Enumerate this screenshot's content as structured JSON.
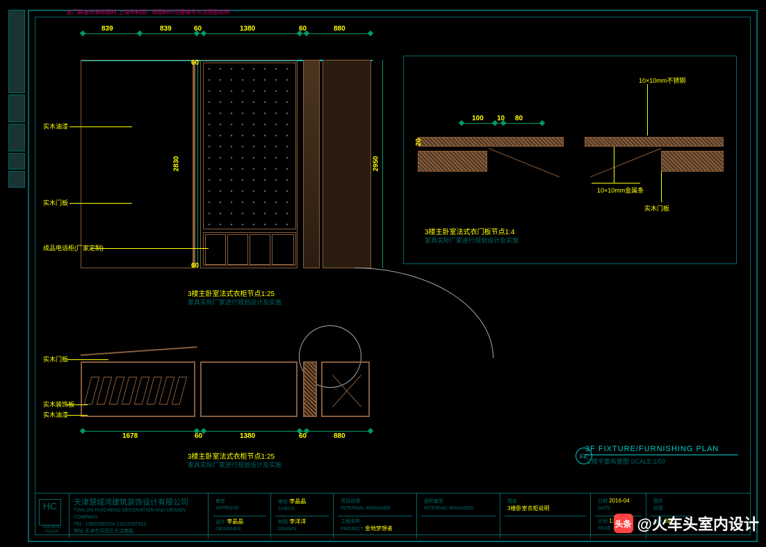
{
  "header": {
    "note": "此门联窗分装修图样 上海市制版厂规图制作活用编号与活用图说明"
  },
  "dimensions": {
    "top": [
      "839",
      "839",
      "60",
      "1380",
      "60",
      "880"
    ],
    "left_height": "2830",
    "right_height": "2950",
    "small_top": "60",
    "small_bottom": "60",
    "bottom": [
      "1678",
      "60",
      "1380",
      "60",
      "880"
    ],
    "detail_top": [
      "100",
      "10",
      "80"
    ],
    "detail_left": "20"
  },
  "labels": {
    "elev_1": "实木油漆",
    "elev_2": "实木门板",
    "elev_3": "成品电话柜(厂家定制)",
    "detail_r1": "10×10mm不锈钢",
    "detail_r2": "10×10mm金属条",
    "detail_r3": "实木门板",
    "plan_1": "实木门板",
    "plan_2": "实木装饰板",
    "plan_3": "实木油漆"
  },
  "captions": {
    "elev_title": "3楼主卧室法式衣柜节点1:25",
    "elev_sub": "家具实际厂家进行规划设计及实施",
    "detail_title": "3楼主卧室法式衣门板节点1:4",
    "detail_sub": "家具实际厂家进行规划设计及实施",
    "plan_title": "3楼主卧室法式衣柜节点1:25",
    "plan_sub": "家具实际厂家进行规划设计及实施"
  },
  "sheet_title": {
    "marker": "FF",
    "en": "3F FIXTURE/FURNISHING PLAN",
    "cn": "三楼平面布置图    SCALE:1/50"
  },
  "title_block": {
    "logo_text": "HC",
    "logo_sub": "HUICHENG DESIGN",
    "company_cn": "天津慧城湾建筑装饰设计有限公司",
    "company_en": "TIAN JIN HUICHENG DECORATION AND DESIGN COMPANY",
    "tel": "TEL: 13820593158  13212097315",
    "addr": "地址:天津市河西区大沽南路"
  },
  "tb_fields": [
    {
      "l1": "审定",
      "v1": "",
      "l2": "APPROVE",
      "v2": ""
    },
    {
      "l1": "设计",
      "v1": "李晶晶",
      "l2": "DESIGNER",
      "v2": ""
    },
    {
      "l1": "审核",
      "v1": "李晶晶",
      "l2": "CHECK",
      "v2": ""
    },
    {
      "l1": "制图",
      "v1": "李洋洋",
      "l2": "DRAWN",
      "v2": ""
    },
    {
      "l1": "项目经理",
      "v1": "",
      "l2": "INTERNAL MANAGER",
      "v2": ""
    },
    {
      "l1": "工程名称",
      "v1": "金地梦想者",
      "l2": "PROJECT",
      "v2": ""
    },
    {
      "l1": "面积套型",
      "v1": "",
      "l2": "INTERNAL MANAGER",
      "v2": ""
    },
    {
      "l1": "图名",
      "v1": "3楼卧室衣柜说明",
      "l2": "",
      "v2": ""
    },
    {
      "l1": "日期",
      "v1": "2016-04",
      "l2": "DATE",
      "v2": ""
    },
    {
      "l1": "比例",
      "v1": "1:50",
      "l2": "PAGE",
      "v2": ""
    },
    {
      "l1": "图号",
      "v1": "02",
      "l2": "",
      "v2": ""
    }
  ],
  "watermark": {
    "icon": "头条",
    "text": "@火车头室内设计"
  }
}
